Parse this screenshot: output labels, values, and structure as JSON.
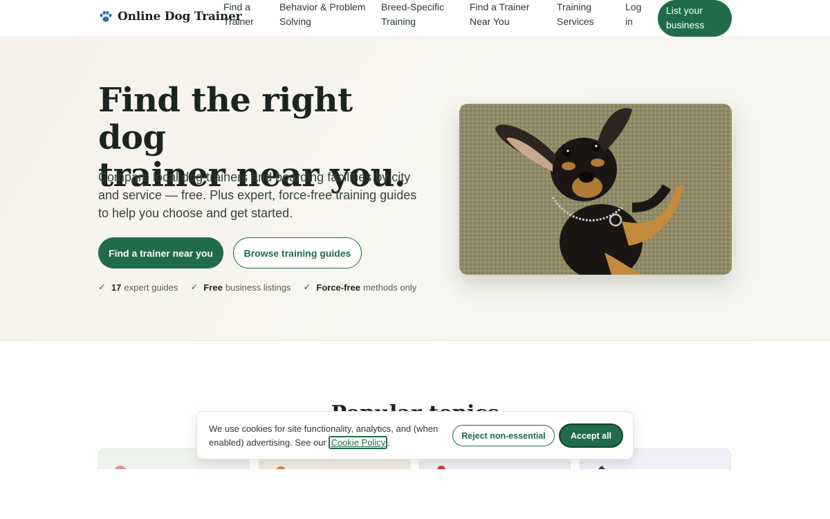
{
  "header": {
    "brand": "Online Dog Trainer",
    "nav": [
      {
        "line1": "Find a",
        "line2": "Trainer"
      },
      {
        "line1": "Behavior & Problem",
        "line2": "Solving"
      },
      {
        "line1": "Breed-Specific",
        "line2": "Training"
      },
      {
        "line1": "Find a Trainer",
        "line2": "Near You"
      },
      {
        "line1": "Training",
        "line2": "Services"
      },
      {
        "line1": "Log",
        "line2": "in"
      }
    ],
    "cta": {
      "line1": "List your",
      "line2": "business"
    }
  },
  "hero": {
    "title_line1": "Find the right dog",
    "title_line2": "trainer near you.",
    "text": "Compare local dog trainers and boarding facilities by city and service — free. Plus expert, force-free training guides to help you choose and get started.",
    "primary_button": "Find a trainer near you",
    "secondary_button": "Browse training guides",
    "badges": [
      {
        "check": "✓",
        "strong": "17",
        "text": "expert guides"
      },
      {
        "check": "✓",
        "strong": "Free",
        "text": "business listings"
      },
      {
        "check": "✓",
        "strong": "Force-free",
        "text": "methods only"
      }
    ]
  },
  "section": {
    "heading": "Popular topics"
  },
  "cookie": {
    "text_before": "We use cookies for site functionality, analytics, and (when enabled) advertising. See our ",
    "link": "Cookie Policy",
    "text_after": ".",
    "reject": "Reject non-essential",
    "accept": "Accept all"
  },
  "colors": {
    "accent": "#1f6b4a",
    "hero_bg": "#f6f2ea",
    "text": "#1b2420"
  }
}
